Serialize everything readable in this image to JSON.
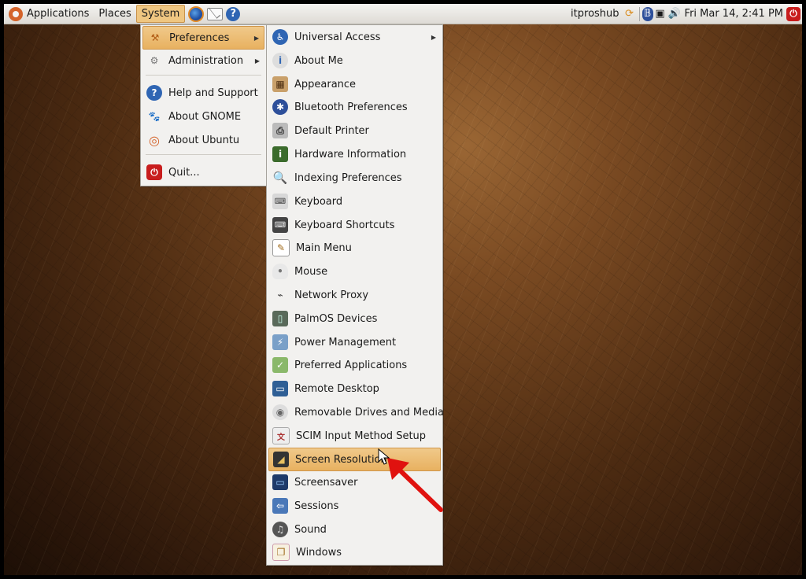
{
  "panel": {
    "menus": [
      "Applications",
      "Places",
      "System"
    ],
    "user": "itproshub",
    "clock": "Fri Mar 14,  2:41 PM"
  },
  "system_menu": {
    "items": [
      {
        "label": "Preferences",
        "icon": "preferences-icon",
        "submenu": true,
        "highlighted": true
      },
      {
        "label": "Administration",
        "icon": "administration-gear-icon",
        "submenu": true
      },
      {
        "label": "Help and Support",
        "icon": "help-icon"
      },
      {
        "label": "About GNOME",
        "icon": "gnome-foot-icon"
      },
      {
        "label": "About Ubuntu",
        "icon": "ubuntu-logo-icon"
      },
      {
        "label": "Quit...",
        "icon": "power-icon"
      }
    ]
  },
  "preferences_menu": {
    "items": [
      {
        "label": "Universal Access",
        "icon": "accessibility-icon",
        "submenu": true
      },
      {
        "label": "About Me",
        "icon": "about-me-icon"
      },
      {
        "label": "Appearance",
        "icon": "appearance-icon"
      },
      {
        "label": "Bluetooth Preferences",
        "icon": "bluetooth-icon"
      },
      {
        "label": "Default Printer",
        "icon": "printer-icon"
      },
      {
        "label": "Hardware Information",
        "icon": "hardware-info-icon"
      },
      {
        "label": "Indexing Preferences",
        "icon": "indexing-icon"
      },
      {
        "label": "Keyboard",
        "icon": "keyboard-icon"
      },
      {
        "label": "Keyboard Shortcuts",
        "icon": "keyboard-shortcuts-icon"
      },
      {
        "label": "Main Menu",
        "icon": "main-menu-icon"
      },
      {
        "label": "Mouse",
        "icon": "mouse-icon"
      },
      {
        "label": "Network Proxy",
        "icon": "network-proxy-icon"
      },
      {
        "label": "PalmOS Devices",
        "icon": "palm-device-icon"
      },
      {
        "label": "Power Management",
        "icon": "power-management-icon"
      },
      {
        "label": "Preferred Applications",
        "icon": "preferred-apps-icon"
      },
      {
        "label": "Remote Desktop",
        "icon": "remote-desktop-icon"
      },
      {
        "label": "Removable Drives and Media",
        "icon": "removable-media-icon"
      },
      {
        "label": "SCIM Input Method Setup",
        "icon": "scim-icon"
      },
      {
        "label": "Screen Resolution",
        "icon": "screen-resolution-icon",
        "highlighted": true
      },
      {
        "label": "Screensaver",
        "icon": "screensaver-icon"
      },
      {
        "label": "Sessions",
        "icon": "sessions-icon"
      },
      {
        "label": "Sound",
        "icon": "sound-icon"
      },
      {
        "label": "Windows",
        "icon": "windows-icon"
      }
    ]
  },
  "colors": {
    "highlight": "#efc681",
    "annotation_arrow": "#e0120f",
    "quit_red": "#c81d1d"
  }
}
